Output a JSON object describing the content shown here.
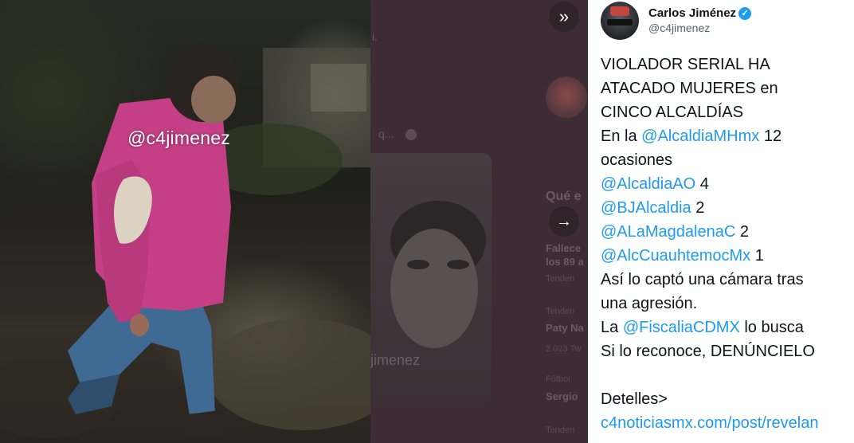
{
  "photo": {
    "watermark": "@c4jimenez"
  },
  "backdrop": {
    "top_text": "i.",
    "faded_name_suffix": "q...",
    "section_heading": "Qué e",
    "trend_1_title": "Fallece",
    "trend_1_sub": "los 89 a",
    "trend_1_meta": "Tenden",
    "trend_2_meta": "Tenden",
    "trend_2_title": "Paty Na",
    "trend_2_count": "2.023 Tw",
    "trend_3_meta": "Fútbol",
    "trend_3_title": "Sergio",
    "trend_4_meta": "Tenden",
    "card_watermark": "jimenez"
  },
  "controls": {
    "collapse_icon": "»",
    "next_icon": "→"
  },
  "tweet": {
    "author_name": "Carlos Jiménez",
    "author_handle": "@c4jimenez",
    "verified_mark": "✓",
    "lines": [
      {
        "parts": [
          {
            "text": "VIOLADOR SERIAL HA",
            "type": "text"
          }
        ]
      },
      {
        "parts": [
          {
            "text": "ATACADO MUJERES en",
            "type": "text"
          }
        ]
      },
      {
        "parts": [
          {
            "text": "CINCO ALCALDÍAS",
            "type": "text"
          }
        ]
      },
      {
        "parts": [
          {
            "text": "En la ",
            "type": "text"
          },
          {
            "text": "@AlcaldiaMHmx",
            "type": "mention"
          },
          {
            "text": " 12",
            "type": "text"
          }
        ]
      },
      {
        "parts": [
          {
            "text": "ocasiones",
            "type": "text"
          }
        ]
      },
      {
        "parts": [
          {
            "text": "@AlcaldiaAO",
            "type": "mention"
          },
          {
            "text": " 4",
            "type": "text"
          }
        ]
      },
      {
        "parts": [
          {
            "text": "@BJAlcaldia",
            "type": "mention"
          },
          {
            "text": " 2",
            "type": "text"
          }
        ]
      },
      {
        "parts": [
          {
            "text": "@ALaMagdalenaC",
            "type": "mention"
          },
          {
            "text": " 2",
            "type": "text"
          }
        ]
      },
      {
        "parts": [
          {
            "text": "@AlcCuauhtemocMx",
            "type": "mention"
          },
          {
            "text": " 1",
            "type": "text"
          }
        ]
      },
      {
        "parts": [
          {
            "text": "Así lo captó una cámara tras",
            "type": "text"
          }
        ]
      },
      {
        "parts": [
          {
            "text": "una agresión.",
            "type": "text"
          }
        ]
      },
      {
        "parts": [
          {
            "text": "La ",
            "type": "text"
          },
          {
            "text": "@FiscaliaCDMX",
            "type": "mention"
          },
          {
            "text": " lo busca",
            "type": "text"
          }
        ]
      },
      {
        "parts": [
          {
            "text": "Si lo reconoce, DENÚNCIELO",
            "type": "text"
          }
        ]
      },
      {
        "parts": []
      },
      {
        "parts": [
          {
            "text": "Detelles>",
            "type": "text"
          }
        ]
      },
      {
        "parts": [
          {
            "text": "c4noticiasmx.com/post/revelan",
            "type": "link"
          }
        ]
      }
    ]
  },
  "colors": {
    "link": "#1d9bf0",
    "text": "#0f1419",
    "handle": "#536471",
    "overlay": "#3d2c36"
  }
}
